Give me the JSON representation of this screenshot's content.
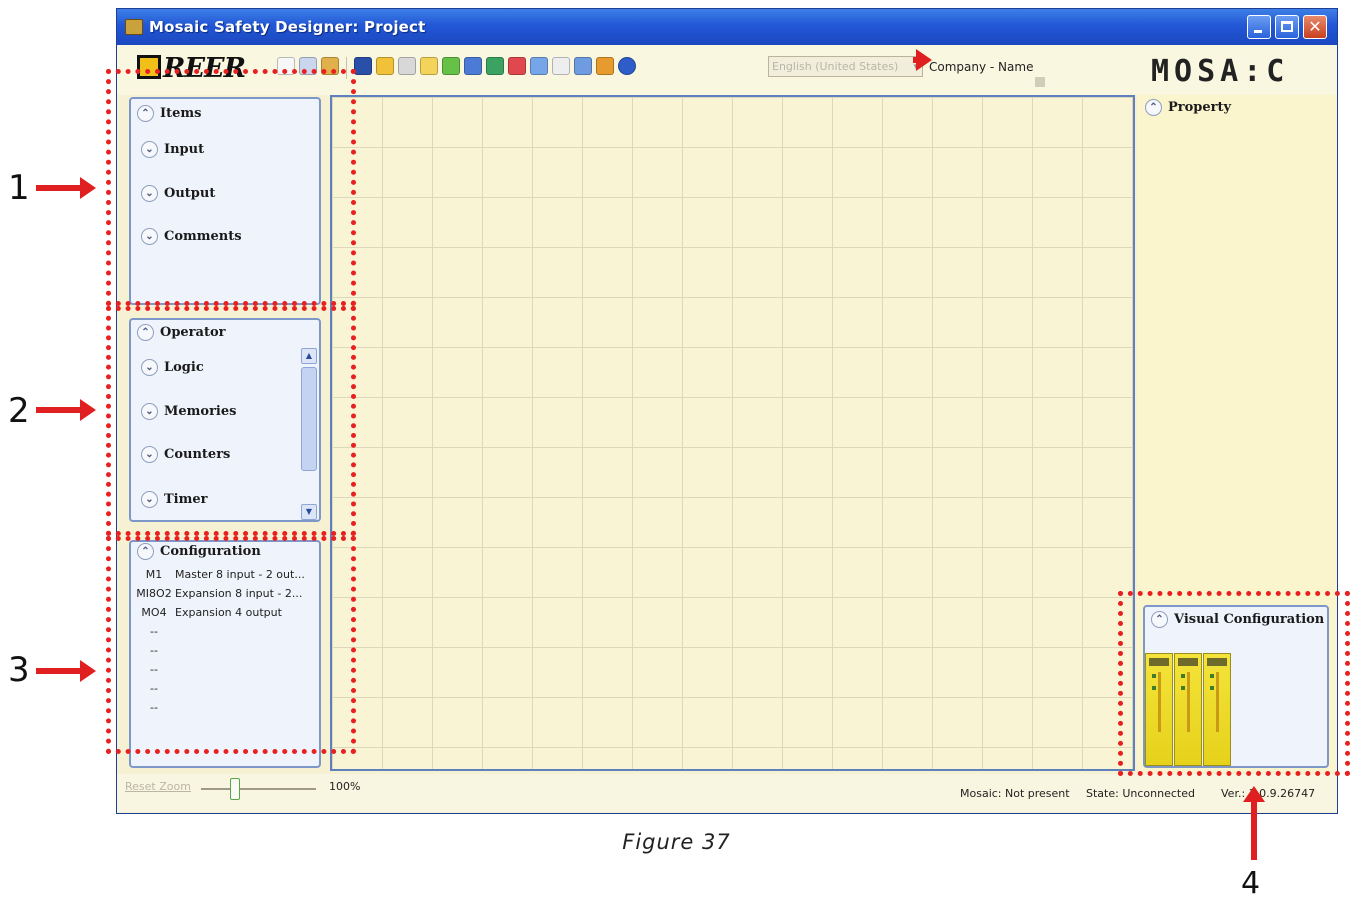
{
  "window": {
    "title": "Mosaic Safety Designer: Project"
  },
  "toolbar": {
    "brand_left": "REER",
    "language": "English (United States)",
    "company_field": "Company - Name",
    "brand_right": "MOSA:C"
  },
  "items_panel": {
    "title": "Items",
    "sections": [
      "Input",
      "Output",
      "Comments"
    ]
  },
  "operator_panel": {
    "title": "Operator",
    "sections": [
      "Logic",
      "Memories",
      "Counters",
      "Timer"
    ]
  },
  "configuration_panel": {
    "title": "Configuration",
    "rows": [
      {
        "code": "M1",
        "desc": "Master 8 input - 2 out..."
      },
      {
        "code": "MI8O2",
        "desc": "Expansion 8 input - 2..."
      },
      {
        "code": "MO4",
        "desc": "Expansion 4 output"
      },
      {
        "code": "--",
        "desc": ""
      },
      {
        "code": "--",
        "desc": ""
      },
      {
        "code": "--",
        "desc": ""
      },
      {
        "code": "--",
        "desc": ""
      },
      {
        "code": "--",
        "desc": ""
      }
    ]
  },
  "property_panel": {
    "title": "Property"
  },
  "visual_panel": {
    "title": "Visual Configuration"
  },
  "statusbar": {
    "reset_zoom": "Reset Zoom",
    "zoom": "100%",
    "mosaic_status": "Mosaic: Not present",
    "state": "State: Unconnected",
    "version": "Ver.: 1.0.9.26747"
  },
  "annotations": {
    "labels": [
      "1",
      "2",
      "3",
      "4"
    ]
  },
  "caption": "Figure 37",
  "colors": {
    "annotation": "#e82020",
    "title_bar": "#2257d6",
    "canvas": "#f8f4d4"
  }
}
